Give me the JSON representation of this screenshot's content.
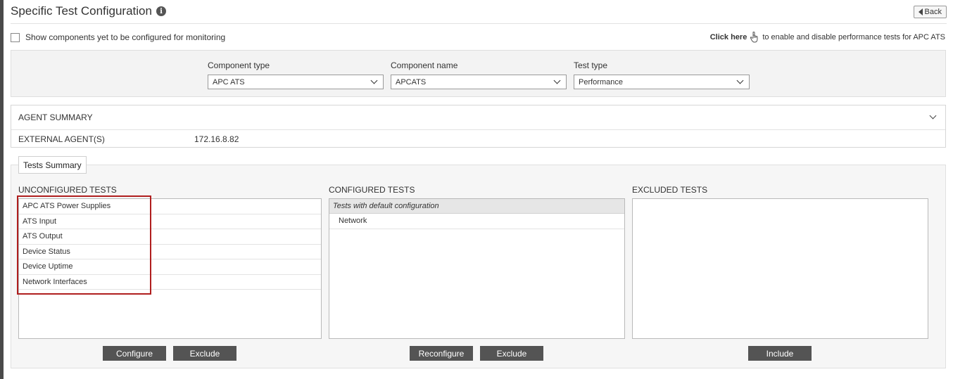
{
  "header": {
    "title": "Specific Test Configuration",
    "info_icon": "i",
    "back_label": "Back"
  },
  "options": {
    "show_components_label": "Show components yet to be configured for monitoring",
    "click_here_label": "Click here",
    "click_here_text": "to enable and disable performance tests for APC ATS"
  },
  "filters": {
    "component_type": {
      "label": "Component type",
      "value": "APC ATS"
    },
    "component_name": {
      "label": "Component name",
      "value": "APCATS"
    },
    "test_type": {
      "label": "Test type",
      "value": "Performance"
    }
  },
  "agent_summary": {
    "title": "AGENT SUMMARY",
    "external_label": "EXTERNAL AGENT(S)",
    "external_value": "172.16.8.82"
  },
  "tests_summary": {
    "tab_label": "Tests Summary",
    "unconfigured": {
      "title": "UNCONFIGURED TESTS",
      "items": [
        "APC ATS Power Supplies",
        "ATS Input",
        "ATS Output",
        "Device Status",
        "Device Uptime",
        "Network Interfaces"
      ],
      "buttons": [
        "Configure",
        "Exclude"
      ]
    },
    "configured": {
      "title": "CONFIGURED TESTS",
      "group_header": "Tests with default configuration",
      "items": [
        "Network"
      ],
      "buttons": [
        "Reconfigure",
        "Exclude"
      ]
    },
    "excluded": {
      "title": "EXCLUDED TESTS",
      "items": [],
      "buttons": [
        "Include"
      ]
    }
  },
  "colors": {
    "button_bg": "#545454",
    "highlight_border": "#b01e1e",
    "panel_bg": "#f3f3f3"
  }
}
